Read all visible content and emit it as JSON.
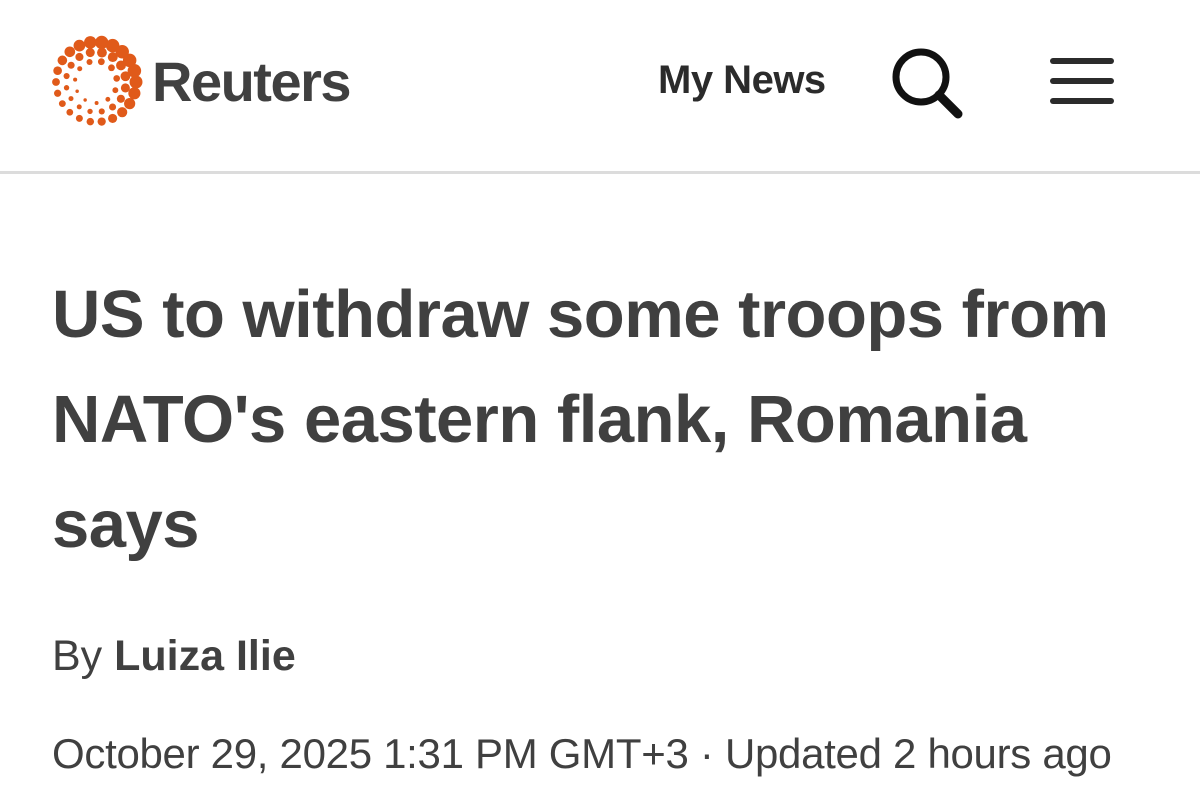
{
  "header": {
    "brand": "Reuters",
    "logo_icon": "reuters-dot-ring-icon",
    "logo_color": "#e05a1a",
    "nav_label": "My News",
    "search_icon": "search-icon",
    "menu_icon": "hamburger-menu-icon"
  },
  "article": {
    "headline": "US to withdraw some troops from NATO's eastern flank, Romania says",
    "byline_prefix": "By",
    "author": "Luiza Ilie",
    "published": "October 29, 2025 1:31 PM GMT+3",
    "separator": "·",
    "updated": "Updated 2 hours ago"
  }
}
